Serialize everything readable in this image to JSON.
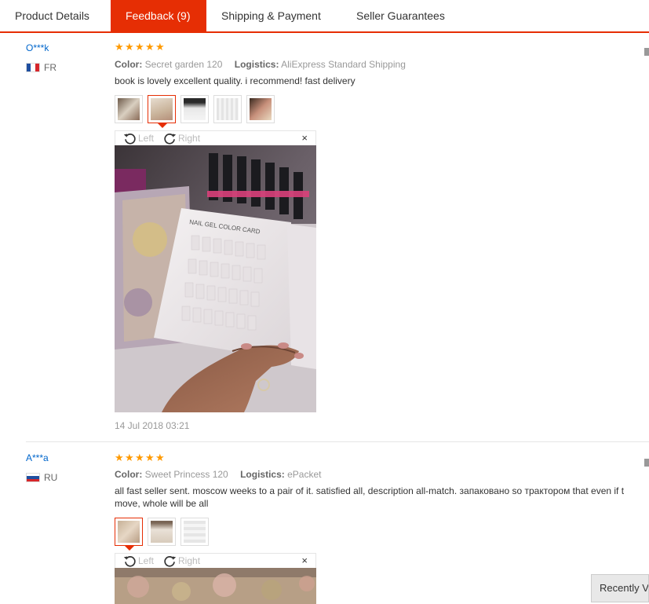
{
  "tabs": [
    {
      "label": "Product Details"
    },
    {
      "label": "Feedback (9)"
    },
    {
      "label": "Shipping & Payment"
    },
    {
      "label": "Seller Guarantees"
    }
  ],
  "reviews": [
    {
      "user": "O***k",
      "country": "FR",
      "rating": 5,
      "color_label": "Color:",
      "color_value": "Secret garden 120",
      "logistics_label": "Logistics:",
      "logistics_value": "AliExpress Standard Shipping",
      "text_lines": [
        "book is lovely excellent quality. i recommend! fast delivery"
      ],
      "thumb_count": 5,
      "selected_thumb": 1,
      "viewer": {
        "left_label": "Left",
        "right_label": "Right",
        "close": "×"
      },
      "date": "14 Jul 2018 03:21"
    },
    {
      "user": "A***a",
      "country": "RU",
      "rating": 5,
      "color_label": "Color:",
      "color_value": "Sweet Princess 120",
      "logistics_label": "Logistics:",
      "logistics_value": "ePacket",
      "text_lines": [
        "all fast seller sent. moscow weeks to a pair of it. satisfied all, description all-match. запаковано so трактором that even if t",
        "move, whole will be all"
      ],
      "thumb_count": 3,
      "selected_thumb": 0,
      "viewer": {
        "left_label": "Left",
        "right_label": "Right",
        "close": "×"
      }
    }
  ],
  "recently_viewed": "Recently Vi",
  "icons": {
    "star": "star-icon",
    "rotate_left": "rotate-left-icon",
    "rotate_right": "rotate-right-icon",
    "close": "close-icon"
  },
  "colors": {
    "accent": "#e62e04",
    "star": "#ff9a00",
    "link": "#0066cc"
  }
}
